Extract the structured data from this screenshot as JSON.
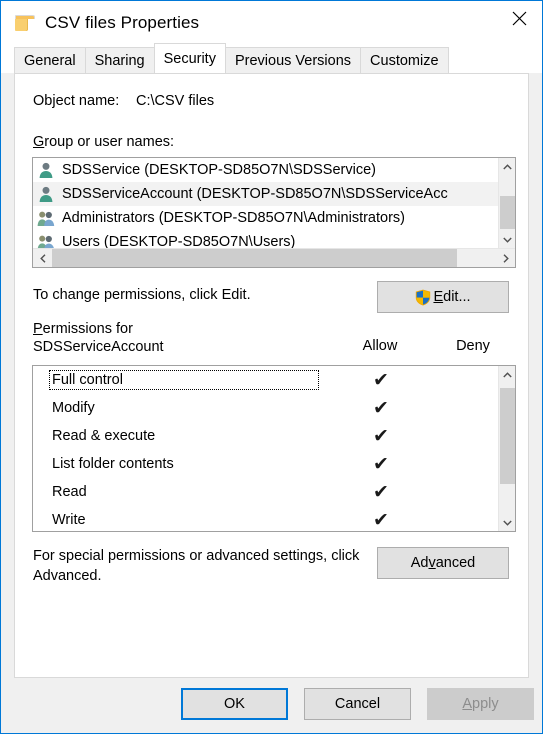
{
  "window": {
    "title": "CSV files Properties",
    "folder_icon": "folder-icon",
    "close_icon": "close-icon",
    "accent_color": "#0078d7",
    "face_color": "#f0f0f0"
  },
  "tabs": [
    {
      "label": "General",
      "active": false
    },
    {
      "label": "Sharing",
      "active": false
    },
    {
      "label": "Security",
      "active": true
    },
    {
      "label": "Previous Versions",
      "active": false
    },
    {
      "label": "Customize",
      "active": false
    }
  ],
  "object": {
    "label": "Object name:",
    "value": "C:\\CSV files"
  },
  "group_list": {
    "label_prefix": "G",
    "label_rest": "roup or user names:",
    "items": [
      {
        "name": "SDSService (DESKTOP-SD85O7N\\SDSService)",
        "icon": "user-icon",
        "selected": false
      },
      {
        "name": "SDSServiceAccount (DESKTOP-SD85O7N\\SDSServiceAcc",
        "icon": "user-icon",
        "selected": true
      },
      {
        "name": "Administrators (DESKTOP-SD85O7N\\Administrators)",
        "icon": "group-icon",
        "selected": false
      },
      {
        "name": "Users (DESKTOP-SD85O7N\\Users)",
        "icon": "group-icon",
        "selected": false
      }
    ],
    "scroll_up_icon": "chevron-up-icon",
    "scroll_down_icon": "chevron-down-icon",
    "scroll_left_icon": "chevron-left-icon",
    "scroll_right_icon": "chevron-right-icon"
  },
  "edit_row": {
    "text": "To change permissions, click Edit.",
    "button_prefix": "",
    "button_accel": "E",
    "button_rest": "dit...",
    "shield_icon": "uac-shield-icon"
  },
  "permissions": {
    "header_accel": "P",
    "header_rest": "ermissions for",
    "header_subject": "SDSServiceAccount",
    "col_allow": "Allow",
    "col_deny": "Deny",
    "check_glyph": "✔",
    "rows": [
      {
        "name": "Full control",
        "allow": true,
        "deny": false,
        "focused": true
      },
      {
        "name": "Modify",
        "allow": true,
        "deny": false,
        "focused": false
      },
      {
        "name": "Read & execute",
        "allow": true,
        "deny": false,
        "focused": false
      },
      {
        "name": "List folder contents",
        "allow": true,
        "deny": false,
        "focused": false
      },
      {
        "name": "Read",
        "allow": true,
        "deny": false,
        "focused": false
      },
      {
        "name": "Write",
        "allow": true,
        "deny": false,
        "focused": false
      }
    ],
    "scroll_up_icon": "chevron-up-icon",
    "scroll_down_icon": "chevron-down-icon"
  },
  "advanced_row": {
    "text": "For special permissions or advanced settings, click Advanced.",
    "button_pre": "Ad",
    "button_accel": "v",
    "button_post": "anced"
  },
  "footer": {
    "ok": "OK",
    "cancel": "Cancel",
    "apply_accel": "A",
    "apply_rest": "pply",
    "apply_disabled": true
  }
}
